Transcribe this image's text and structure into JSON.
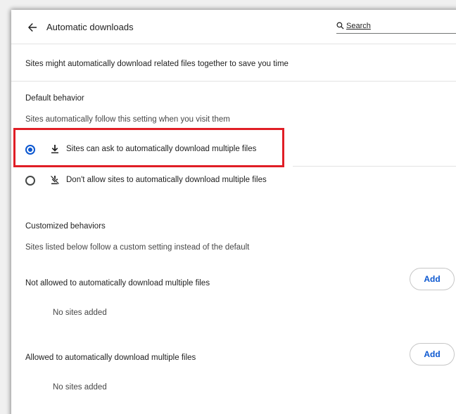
{
  "header": {
    "title": "Automatic downloads",
    "back_icon": "arrow-back-icon",
    "search_placeholder": "Search",
    "search_icon": "search-icon"
  },
  "intro": "Sites might automatically download related files together to save you time",
  "default_behavior": {
    "heading": "Default behavior",
    "subtitle": "Sites automatically follow this setting when you visit them",
    "options": [
      {
        "label": "Sites can ask to automatically download multiple files",
        "icon": "download-icon",
        "selected": true
      },
      {
        "label": "Don't allow sites to automatically download multiple files",
        "icon": "download-blocked-icon",
        "selected": false
      }
    ]
  },
  "customized": {
    "heading": "Customized behaviors",
    "subtitle": "Sites listed below follow a custom setting instead of the default",
    "lists": [
      {
        "label": "Not allowed to automatically download multiple files",
        "add_label": "Add",
        "empty_text": "No sites added"
      },
      {
        "label": "Allowed to automatically download multiple files",
        "add_label": "Add",
        "empty_text": "No sites added"
      }
    ]
  },
  "colors": {
    "accent": "#0b57d0",
    "highlight_border": "#e01e26",
    "text": "#1f1f1f",
    "secondary_text": "#474747"
  }
}
